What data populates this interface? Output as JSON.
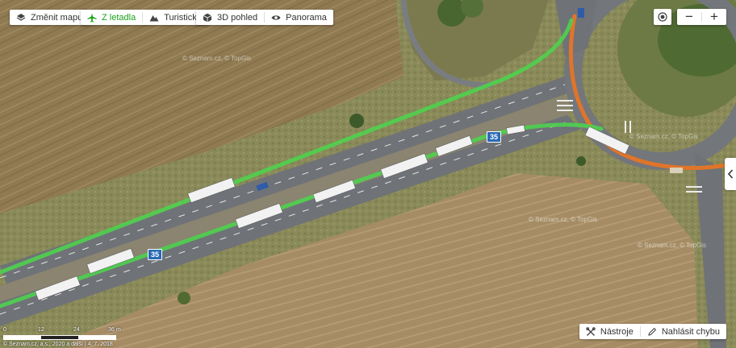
{
  "toolbar": {
    "change_map": "Změnit mapu",
    "aerial": "Z letadla",
    "tourist": "Turistická",
    "view_3d": "3D pohled",
    "panorama": "Panorama",
    "active_color": "#1aa31a"
  },
  "zoom": {
    "minus": "−",
    "plus": "+"
  },
  "bottom_tools": {
    "tools": "Nástroje",
    "report_error": "Nahlásit chybu"
  },
  "scale": {
    "labels": [
      "0",
      "12",
      "24",
      "36",
      "m"
    ]
  },
  "copyright": "© Seznam.cz, a.s., 2020 a další | 4. 7. 2018",
  "watermark": "© Seznam.cz, © TopGis",
  "road_numbers": [
    "35",
    "35"
  ],
  "icons": {
    "change_map": "layers-icon",
    "aerial": "airplane-icon",
    "tourist": "mountain-icon",
    "view_3d": "cube-icon",
    "panorama": "eye-icon",
    "locate": "locate-icon",
    "tools": "tools-icon",
    "report_error": "pencil-icon",
    "side_tab": "chevron-left-icon"
  },
  "colors": {
    "route_green": "#4ed24e",
    "route_orange": "#e0742a",
    "road_shield": "#2a6bb5"
  }
}
